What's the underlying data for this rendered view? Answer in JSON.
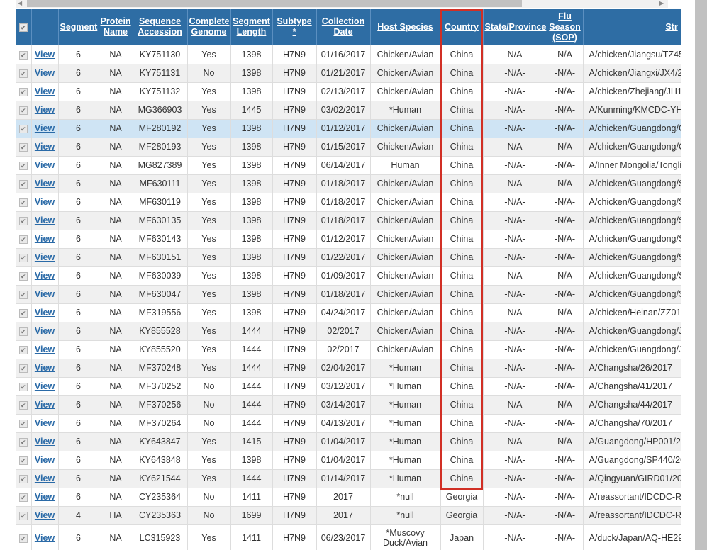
{
  "headers": {
    "segment": "Segment",
    "protein": "Protein Name",
    "accession": "Sequence Accession",
    "complete": "Complete Genome",
    "length": "Segment Length",
    "subtype": "Subtype *",
    "date": "Collection Date",
    "host": "Host Species",
    "country": "Country",
    "state": "State/Province",
    "flu": "Flu Season (SOP)",
    "strain": "Str"
  },
  "view_label": "View",
  "highlight_color": "#d12f25",
  "rows": [
    [
      "6",
      "NA",
      "KY751130",
      "Yes",
      "1398",
      "H7N9",
      "01/16/2017",
      "Chicken/Avian",
      "China",
      "-N/A-",
      "-N/A-",
      "A/chicken/Jiangsu/TZ45/"
    ],
    [
      "6",
      "NA",
      "KY751131",
      "No",
      "1398",
      "H7N9",
      "01/21/2017",
      "Chicken/Avian",
      "China",
      "-N/A-",
      "-N/A-",
      "A/chicken/Jiangxi/JX4/20"
    ],
    [
      "6",
      "NA",
      "KY751132",
      "Yes",
      "1398",
      "H7N9",
      "02/13/2017",
      "Chicken/Avian",
      "China",
      "-N/A-",
      "-N/A-",
      "A/chicken/Zhejiang/JH1"
    ],
    [
      "6",
      "NA",
      "MG366903",
      "Yes",
      "1445",
      "H7N9",
      "03/02/2017",
      "*Human",
      "China",
      "-N/A-",
      "-N/A-",
      "A/Kunming/KMCDC-YH"
    ],
    [
      "6",
      "NA",
      "MF280192",
      "Yes",
      "1398",
      "H7N9",
      "01/12/2017",
      "Chicken/Avian",
      "China",
      "-N/A-",
      "-N/A-",
      "A/chicken/Guangdong/C"
    ],
    [
      "6",
      "NA",
      "MF280193",
      "Yes",
      "1398",
      "H7N9",
      "01/15/2017",
      "Chicken/Avian",
      "China",
      "-N/A-",
      "-N/A-",
      "A/chicken/Guangdong/C"
    ],
    [
      "6",
      "NA",
      "MG827389",
      "Yes",
      "1398",
      "H7N9",
      "06/14/2017",
      "Human",
      "China",
      "-N/A-",
      "-N/A-",
      "A/Inner Mongolia/Tonglia"
    ],
    [
      "6",
      "NA",
      "MF630111",
      "Yes",
      "1398",
      "H7N9",
      "01/18/2017",
      "Chicken/Avian",
      "China",
      "-N/A-",
      "-N/A-",
      "A/chicken/Guangdong/S"
    ],
    [
      "6",
      "NA",
      "MF630119",
      "Yes",
      "1398",
      "H7N9",
      "01/18/2017",
      "Chicken/Avian",
      "China",
      "-N/A-",
      "-N/A-",
      "A/chicken/Guangdong/S"
    ],
    [
      "6",
      "NA",
      "MF630135",
      "Yes",
      "1398",
      "H7N9",
      "01/18/2017",
      "Chicken/Avian",
      "China",
      "-N/A-",
      "-N/A-",
      "A/chicken/Guangdong/S"
    ],
    [
      "6",
      "NA",
      "MF630143",
      "Yes",
      "1398",
      "H7N9",
      "01/12/2017",
      "Chicken/Avian",
      "China",
      "-N/A-",
      "-N/A-",
      "A/chicken/Guangdong/S"
    ],
    [
      "6",
      "NA",
      "MF630151",
      "Yes",
      "1398",
      "H7N9",
      "01/22/2017",
      "Chicken/Avian",
      "China",
      "-N/A-",
      "-N/A-",
      "A/chicken/Guangdong/S"
    ],
    [
      "6",
      "NA",
      "MF630039",
      "Yes",
      "1398",
      "H7N9",
      "01/09/2017",
      "Chicken/Avian",
      "China",
      "-N/A-",
      "-N/A-",
      "A/chicken/Guangdong/S"
    ],
    [
      "6",
      "NA",
      "MF630047",
      "Yes",
      "1398",
      "H7N9",
      "01/18/2017",
      "Chicken/Avian",
      "China",
      "-N/A-",
      "-N/A-",
      "A/chicken/Guangdong/S"
    ],
    [
      "6",
      "NA",
      "MF319556",
      "Yes",
      "1398",
      "H7N9",
      "04/24/2017",
      "Chicken/Avian",
      "China",
      "-N/A-",
      "-N/A-",
      "A/chicken/Heinan/ZZ01/"
    ],
    [
      "6",
      "NA",
      "KY855528",
      "Yes",
      "1444",
      "H7N9",
      "02/2017",
      "Chicken/Avian",
      "China",
      "-N/A-",
      "-N/A-",
      "A/chicken/Guangdong/J"
    ],
    [
      "6",
      "NA",
      "KY855520",
      "Yes",
      "1444",
      "H7N9",
      "02/2017",
      "Chicken/Avian",
      "China",
      "-N/A-",
      "-N/A-",
      "A/chicken/Guangdong/J"
    ],
    [
      "6",
      "NA",
      "MF370248",
      "Yes",
      "1444",
      "H7N9",
      "02/04/2017",
      "*Human",
      "China",
      "-N/A-",
      "-N/A-",
      "A/Changsha/26/2017"
    ],
    [
      "6",
      "NA",
      "MF370252",
      "No",
      "1444",
      "H7N9",
      "03/12/2017",
      "*Human",
      "China",
      "-N/A-",
      "-N/A-",
      "A/Changsha/41/2017"
    ],
    [
      "6",
      "NA",
      "MF370256",
      "No",
      "1444",
      "H7N9",
      "03/14/2017",
      "*Human",
      "China",
      "-N/A-",
      "-N/A-",
      "A/Changsha/44/2017"
    ],
    [
      "6",
      "NA",
      "MF370264",
      "No",
      "1444",
      "H7N9",
      "04/13/2017",
      "*Human",
      "China",
      "-N/A-",
      "-N/A-",
      "A/Changsha/70/2017"
    ],
    [
      "6",
      "NA",
      "KY643847",
      "Yes",
      "1415",
      "H7N9",
      "01/04/2017",
      "*Human",
      "China",
      "-N/A-",
      "-N/A-",
      "A/Guangdong/HP001/20"
    ],
    [
      "6",
      "NA",
      "KY643848",
      "Yes",
      "1398",
      "H7N9",
      "01/04/2017",
      "*Human",
      "China",
      "-N/A-",
      "-N/A-",
      "A/Guangdong/SP440/20"
    ],
    [
      "6",
      "NA",
      "KY621544",
      "Yes",
      "1444",
      "H7N9",
      "01/14/2017",
      "*Human",
      "China",
      "-N/A-",
      "-N/A-",
      "A/Qingyuan/GIRD01/201"
    ],
    [
      "6",
      "NA",
      "CY235364",
      "No",
      "1411",
      "H7N9",
      "2017",
      "*null",
      "Georgia",
      "-N/A-",
      "-N/A-",
      "A/reassortant/IDCDC-R"
    ],
    [
      "4",
      "HA",
      "CY235363",
      "No",
      "1699",
      "H7N9",
      "2017",
      "*null",
      "Georgia",
      "-N/A-",
      "-N/A-",
      "A/reassortant/IDCDC-R"
    ],
    [
      "6",
      "NA",
      "LC315923",
      "Yes",
      "1411",
      "H7N9",
      "06/23/2017",
      "*Muscovy Duck/Avian",
      "Japan",
      "-N/A-",
      "-N/A-",
      "A/duck/Japan/AQ-HE29-"
    ]
  ]
}
